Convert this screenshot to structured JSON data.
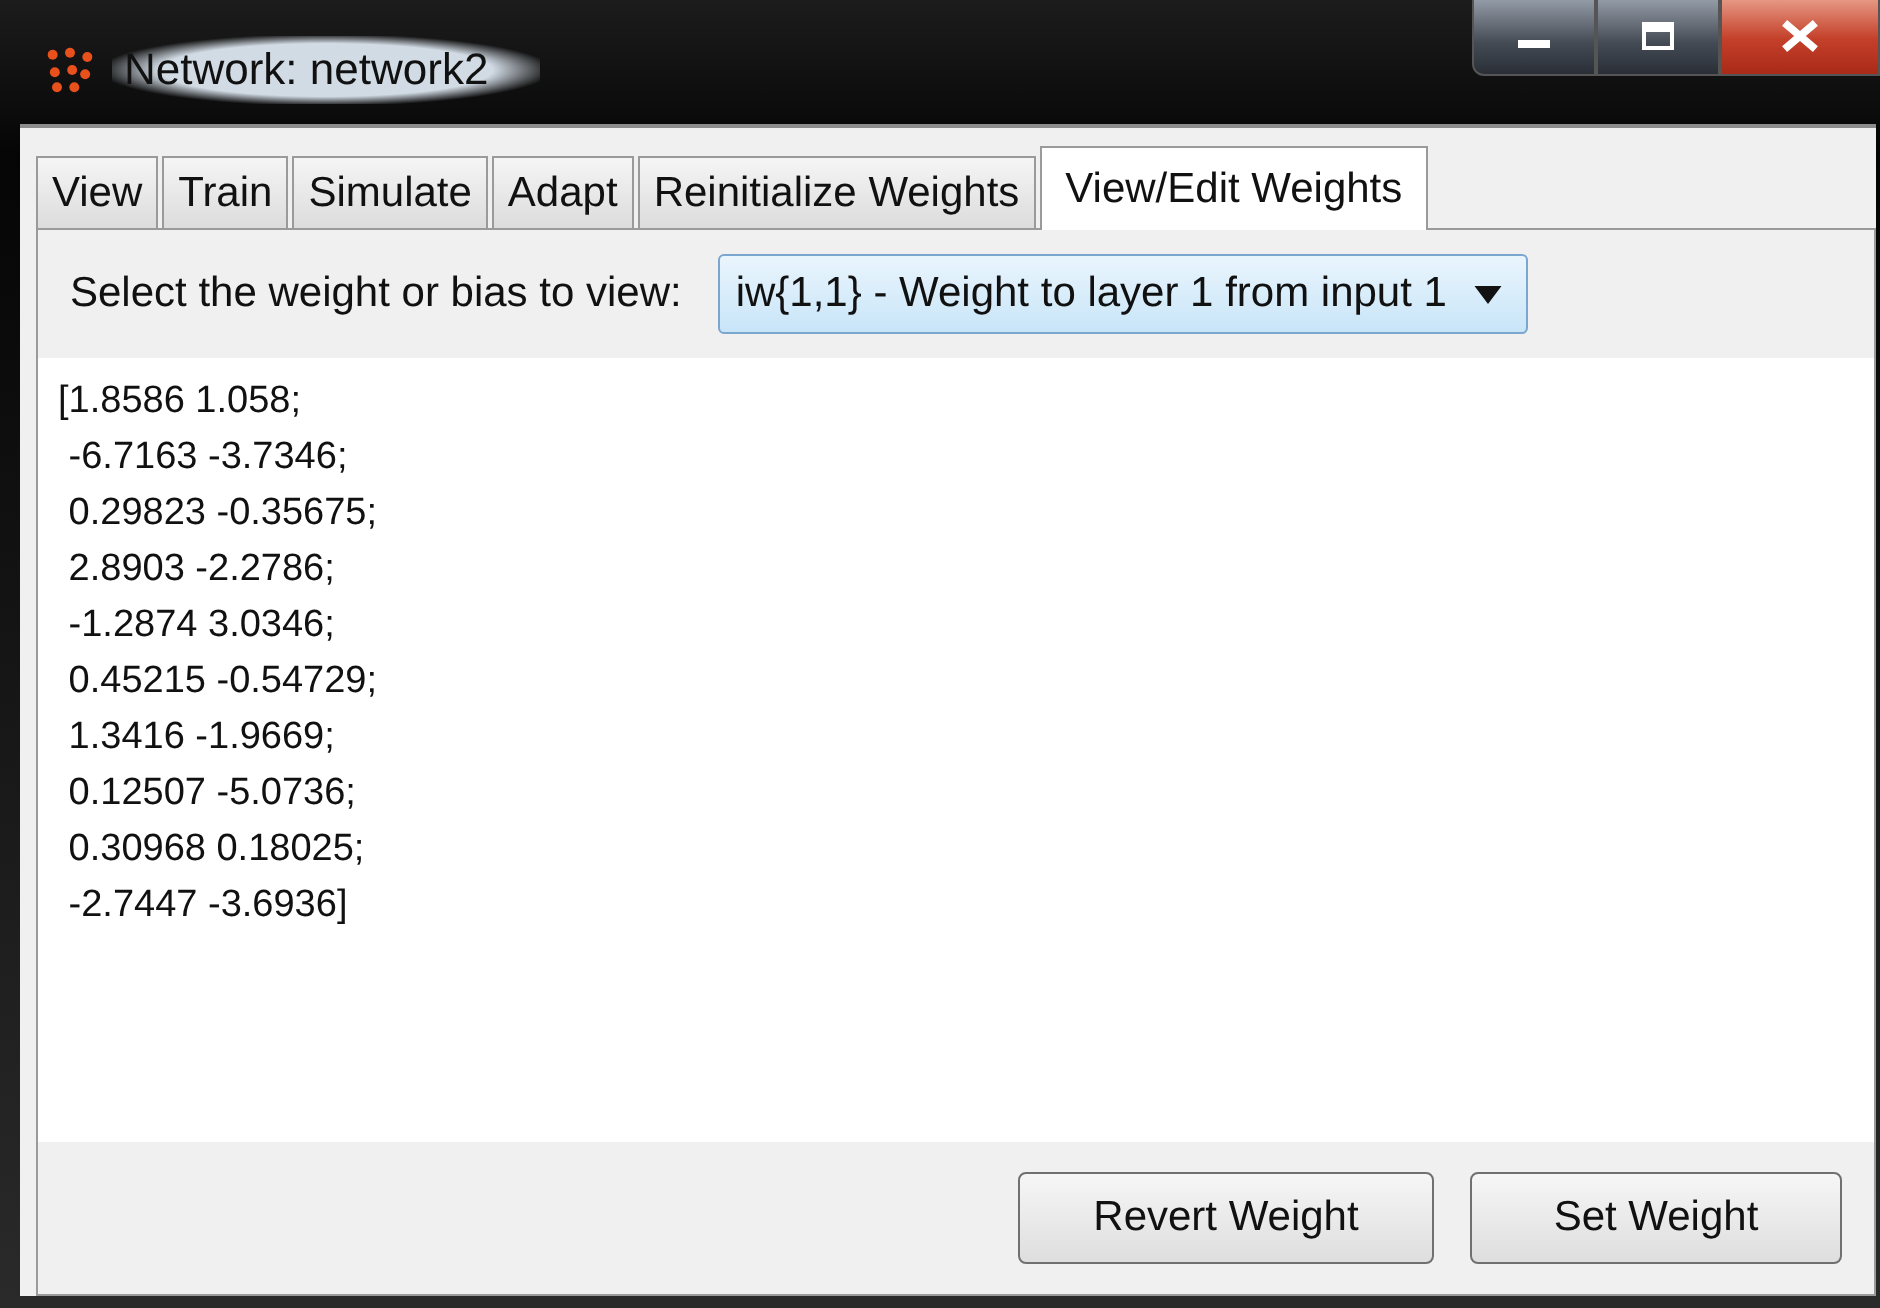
{
  "window": {
    "title": "Network: network2"
  },
  "tabs": [
    {
      "label": "View",
      "selected": false
    },
    {
      "label": "Train",
      "selected": false
    },
    {
      "label": "Simulate",
      "selected": false
    },
    {
      "label": "Adapt",
      "selected": false
    },
    {
      "label": "Reinitialize Weights",
      "selected": false
    },
    {
      "label": "View/Edit Weights",
      "selected": true
    }
  ],
  "selector": {
    "label": "Select the weight or bias to view:",
    "value": "iw{1,1} - Weight to layer 1 from input 1"
  },
  "editor": {
    "lines": [
      "[1.8586 1.058;",
      " -6.7163 -3.7346;",
      " 0.29823 -0.35675;",
      " 2.8903 -2.2786;",
      " -1.2874 3.0346;",
      " 0.45215 -0.54729;",
      " 1.3416 -1.9669;",
      " 0.12507 -5.0736;",
      " 0.30968 0.18025;",
      " -2.7447 -3.6936]"
    ]
  },
  "buttons": [
    "Revert Weight",
    "Set Weight"
  ]
}
